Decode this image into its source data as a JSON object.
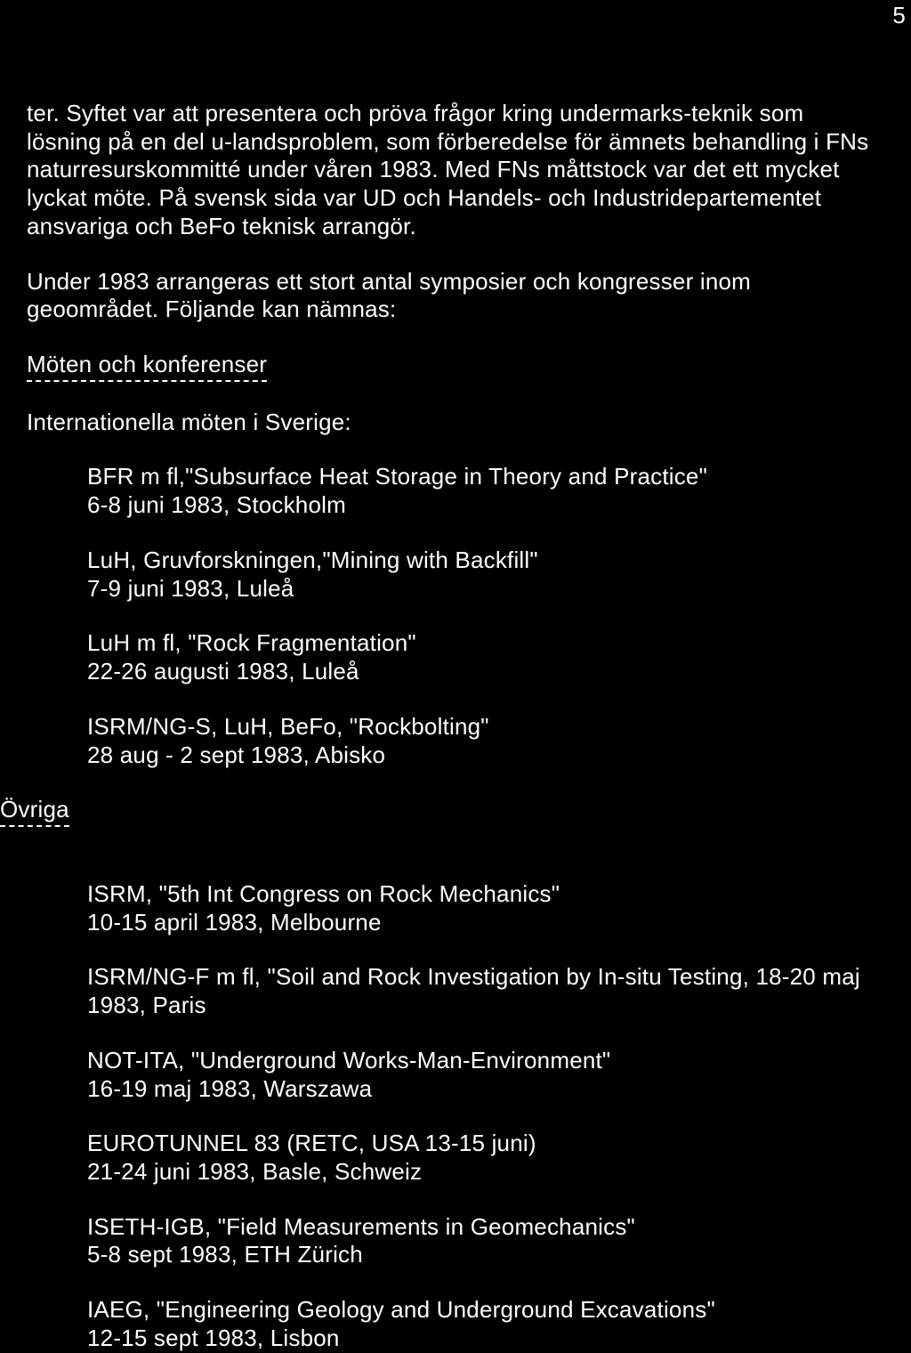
{
  "page_number": "5",
  "paragraphs": {
    "p1": "ter. Syftet var att presentera och pröva frågor kring undermarks-teknik som lösning på en del u-landsproblem, som förberedelse för ämnets behandling i FNs naturresurskommitté under våren 1983. Med FNs måttstock var det ett mycket lyckat möte. På svensk sida var UD och Handels- och Industridepartementet ansvariga och BeFo teknisk arrangör.",
    "p2": "Under 1983 arrangeras ett stort antal symposier och kongresser inom geoområdet. Följande kan nämnas:"
  },
  "headings": {
    "h1": "Möten och konferenser",
    "h2": "Internationella möten i Sverige:",
    "h3": "Övriga"
  },
  "meetings": [
    "BFR m fl,\"Subsurface Heat Storage in Theory and Practice\"\n6-8 juni 1983, Stockholm",
    "LuH, Gruvforskningen,\"Mining with Backfill\"\n7-9 juni 1983, Luleå",
    "LuH m fl, \"Rock Fragmentation\"\n22-26 augusti 1983, Luleå",
    "ISRM/NG-S, LuH, BeFo, \"Rockbolting\"\n28 aug - 2 sept 1983, Abisko"
  ],
  "other": [
    "ISRM, \"5th Int Congress on Rock Mechanics\"\n10-15 april 1983, Melbourne",
    "ISRM/NG-F m fl, \"Soil and Rock Investigation by In-situ Testing, 18-20 maj 1983, Paris",
    "NOT-ITA, \"Underground Works-Man-Environment\"\n16-19 maj 1983, Warszawa",
    "EUROTUNNEL 83 (RETC, USA 13-15 juni)\n21-24 juni 1983, Basle, Schweiz",
    "ISETH-IGB, \"Field Measurements in Geomechanics\"\n5-8 sept 1983, ETH Zürich",
    "IAEG, \"Engineering Geology and Underground Excavations\"\n12-15 sept 1983, Lisbon"
  ]
}
